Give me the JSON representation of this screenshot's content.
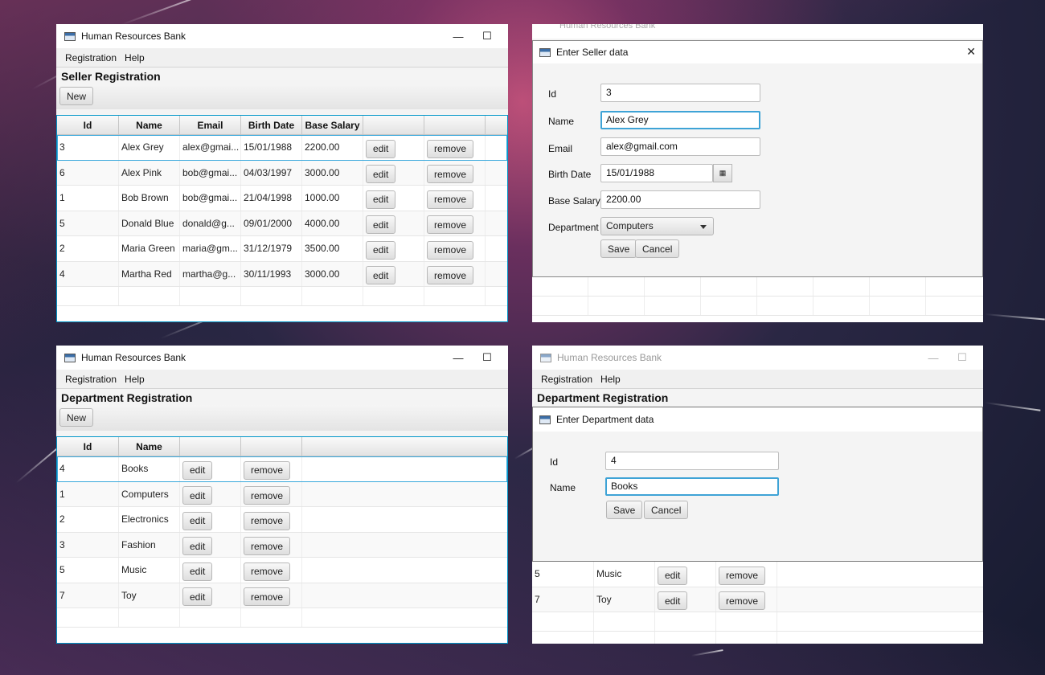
{
  "app_title": "Human Resources Bank",
  "menu": {
    "registration": "Registration",
    "help": "Help"
  },
  "window_controls": {
    "minimize": "—",
    "maximize": "☐",
    "close": "✕"
  },
  "seller_window": {
    "section_title": "Seller Registration",
    "new_label": "New",
    "columns": [
      "Id",
      "Name",
      "Email",
      "Birth Date",
      "Base Salary"
    ],
    "rows": [
      {
        "id": "3",
        "name": "Alex Grey",
        "email": "alex@gmai...",
        "birth": "15/01/1988",
        "salary": "2200.00"
      },
      {
        "id": "6",
        "name": "Alex Pink",
        "email": "bob@gmai...",
        "birth": "04/03/1997",
        "salary": "3000.00"
      },
      {
        "id": "1",
        "name": "Bob Brown",
        "email": "bob@gmai...",
        "birth": "21/04/1998",
        "salary": "1000.00"
      },
      {
        "id": "5",
        "name": "Donald Blue",
        "email": "donald@g...",
        "birth": "09/01/2000",
        "salary": "4000.00"
      },
      {
        "id": "2",
        "name": "Maria Green",
        "email": "maria@gm...",
        "birth": "31/12/1979",
        "salary": "3500.00"
      },
      {
        "id": "4",
        "name": "Martha Red",
        "email": "martha@g...",
        "birth": "30/11/1993",
        "salary": "3000.00"
      }
    ],
    "edit_label": "edit",
    "remove_label": "remove"
  },
  "seller_dialog": {
    "title": "Enter Seller data",
    "labels": {
      "id": "Id",
      "name": "Name",
      "email": "Email",
      "birth": "Birth Date",
      "salary": "Base Salary",
      "department": "Department"
    },
    "values": {
      "id": "3",
      "name": "Alex Grey",
      "email": "alex@gmail.com",
      "birth": "15/01/1988",
      "salary": "2200.00",
      "department": "Computers"
    },
    "save_label": "Save",
    "cancel_label": "Cancel"
  },
  "department_window": {
    "section_title": "Department Registration",
    "new_label": "New",
    "columns": [
      "Id",
      "Name"
    ],
    "rows": [
      {
        "id": "4",
        "name": "Books"
      },
      {
        "id": "1",
        "name": "Computers"
      },
      {
        "id": "2",
        "name": "Electronics"
      },
      {
        "id": "3",
        "name": "Fashion"
      },
      {
        "id": "5",
        "name": "Music"
      },
      {
        "id": "7",
        "name": "Toy"
      }
    ],
    "edit_label": "edit",
    "remove_label": "remove"
  },
  "department_window_2": {
    "section_title": "Department Registration",
    "visible_rows": [
      {
        "id": "5",
        "name": "Music"
      },
      {
        "id": "7",
        "name": "Toy"
      }
    ]
  },
  "department_dialog": {
    "title": "Enter Department data",
    "labels": {
      "id": "Id",
      "name": "Name"
    },
    "values": {
      "id": "4",
      "name": "Books"
    },
    "save_label": "Save",
    "cancel_label": "Cancel"
  }
}
